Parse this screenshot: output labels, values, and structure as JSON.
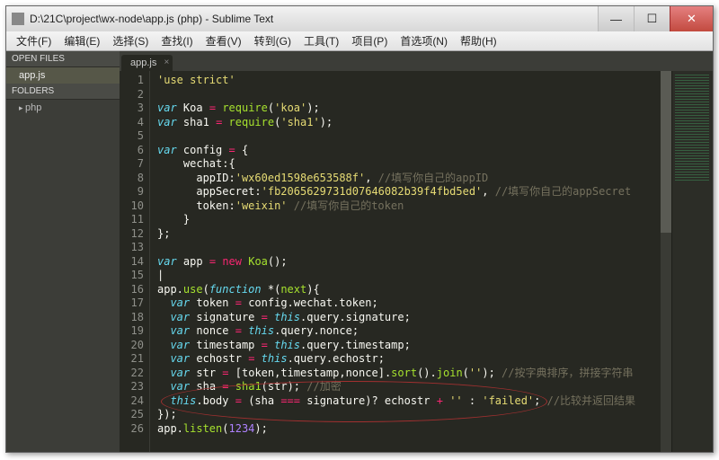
{
  "title": "D:\\21C\\project\\wx-node\\app.js (php) - Sublime Text",
  "menus": [
    "文件(F)",
    "编辑(E)",
    "选择(S)",
    "查找(I)",
    "查看(V)",
    "转到(G)",
    "工具(T)",
    "项目(P)",
    "首选项(N)",
    "帮助(H)"
  ],
  "sidebar": {
    "open_files": "OPEN FILES",
    "file": "app.js",
    "folders": "FOLDERS",
    "folder": "php"
  },
  "tab": {
    "label": "app.js"
  },
  "lnums": [
    "1",
    "2",
    "3",
    "4",
    "5",
    "6",
    "7",
    "8",
    "9",
    "10",
    "11",
    "12",
    "13",
    "14",
    "15",
    "16",
    "17",
    "18",
    "19",
    "20",
    "21",
    "22",
    "23",
    "24",
    "25",
    "26"
  ],
  "code": {
    "s_use": "'use strict'",
    "kw_var": "var",
    "op_eq": "=",
    "op_new": "new",
    "id_koa": "Koa",
    "id_req": "require",
    "s_koa": "'koa'",
    "id_sha1": "sha1",
    "s_sha1": "'sha1'",
    "id_cfg": "config",
    "id_wechat": "wechat",
    "k_appid": "appID",
    "s_appid": "'wx60ed1598e653588f'",
    "c_appid": "//填写你自己的appID",
    "k_secret": "appSecret",
    "s_secret": "'fb2065629731d07646082b39f4fbd5ed'",
    "c_secret": "//填写你自己的appSecret",
    "k_token": "token",
    "s_tok": "'weixin'",
    "c_tok": "//填写你自己的token",
    "id_app": "app",
    "fn_koa": "Koa",
    "id_use": "use",
    "kw_fn": "function",
    "id_next": "next",
    "id_token": "token",
    "p_tok": "config.wechat.token",
    "id_sig": "signature",
    "kw_this": "this",
    "p_sig": ".query.signature",
    "id_nonce": "nonce",
    "p_nonce": ".query.nonce",
    "id_ts": "timestamp",
    "p_ts": ".query.timestamp",
    "id_echo": "echostr",
    "p_echo": ".query.echostr",
    "id_str": "str",
    "arr": "[token,timestamp,nonce]",
    "fn_sort": "sort",
    "fn_join": "join",
    "s_emp": "''",
    "c_sort": "//按字典排序，拼接字符串",
    "id_sha": "sha",
    "c_enc": "//加密",
    "id_body": "body",
    "s_fail": "'failed'",
    "c_cmp": "//比较并返回结果",
    "fn_listen": "listen",
    "n_port": "1234"
  }
}
